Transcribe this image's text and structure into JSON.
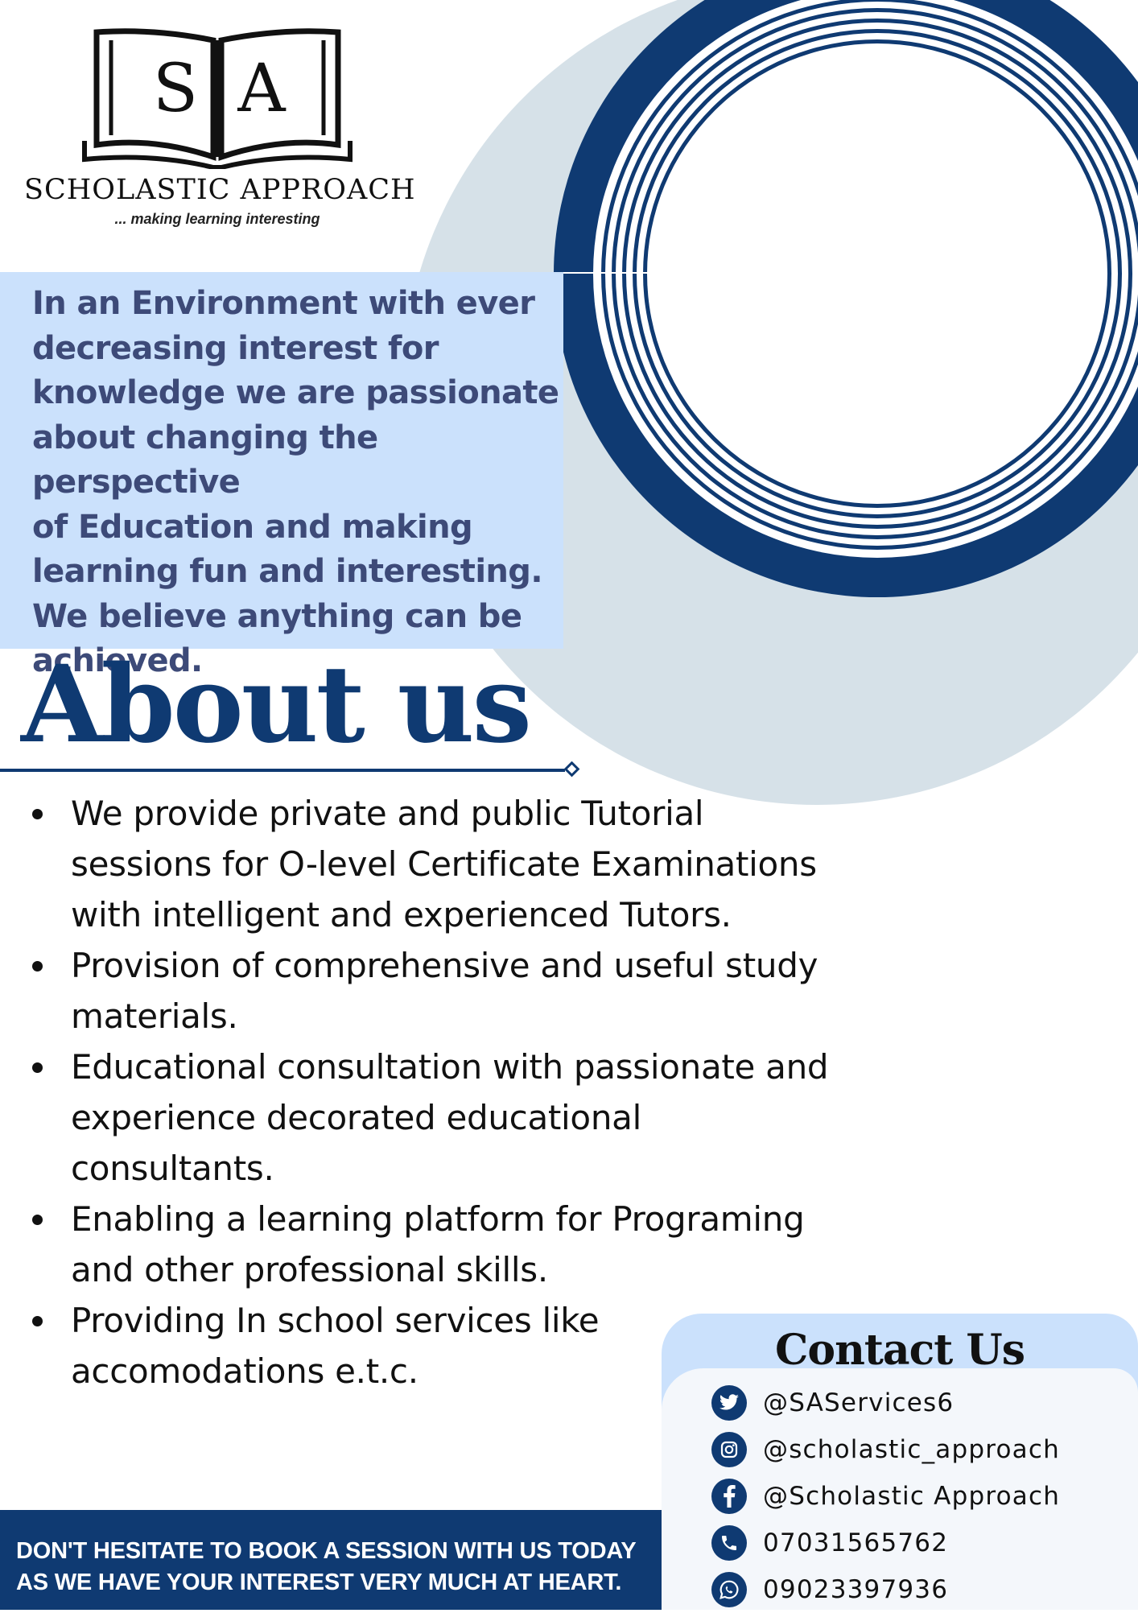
{
  "brand": {
    "logo_letters": "SA",
    "logo_letter_left": "S",
    "logo_letter_right": "A",
    "name": "SCHOLASTIC APPROACH",
    "tagline": "... making learning interesting"
  },
  "intro": {
    "lines": [
      "In an Environment with ever",
      "decreasing interest for",
      "knowledge we are passionate",
      "about changing the perspective",
      "of Education and making",
      "learning fun and interesting.",
      "We believe anything can be",
      "achieved."
    ]
  },
  "about": {
    "title": "About us",
    "services": [
      [
        "We provide private and public Tutorial",
        "sessions for O-level Certificate Examinations",
        "with intelligent and experienced Tutors."
      ],
      [
        "Provision of comprehensive and useful study",
        "materials."
      ],
      [
        "Educational consultation with passionate and",
        "experience decorated educational",
        "consultants."
      ],
      [
        "Enabling a learning platform for Programing",
        "and other professional skills."
      ],
      [
        "Providing In school services like",
        "accomodations e.t.c."
      ]
    ]
  },
  "contact": {
    "title": "Contact Us",
    "items": [
      {
        "icon": "twitter-icon",
        "text": "@SAServices6"
      },
      {
        "icon": "instagram-icon",
        "text": "@scholastic_approach"
      },
      {
        "icon": "facebook-icon",
        "text": "@Scholastic Approach"
      },
      {
        "icon": "phone-icon",
        "text": "07031565762"
      },
      {
        "icon": "whatsapp-icon",
        "text": "09023397936"
      }
    ]
  },
  "cta": {
    "line1": "DON'T HESITATE TO BOOK A SESSION WITH US TODAY",
    "line2": "AS WE HAVE YOUR INTEREST VERY MUCH AT HEART."
  },
  "colors": {
    "navy": "#0f3a72",
    "light_blue": "#cbe1fc",
    "pale_gray_blue": "#d6e1e8",
    "intro_text": "#3d4a78"
  }
}
